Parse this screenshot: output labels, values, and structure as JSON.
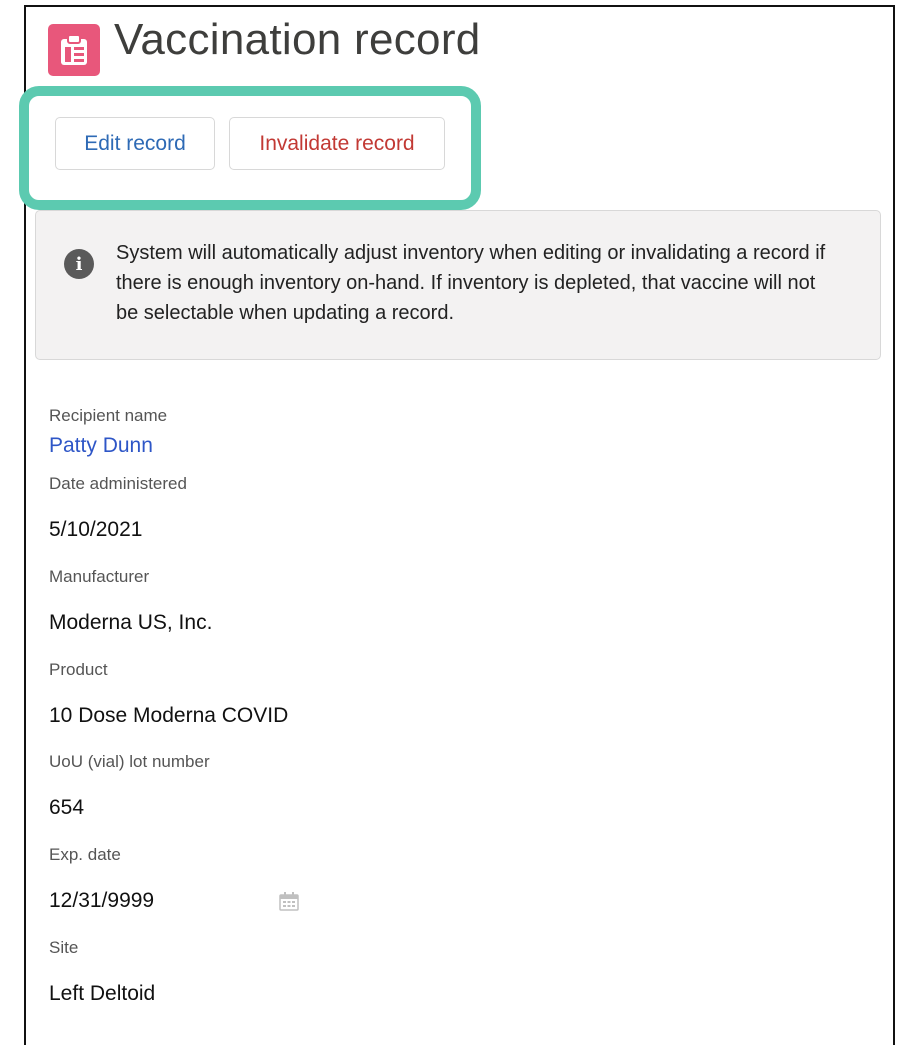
{
  "header": {
    "title": "Vaccination record",
    "icon": "clipboard-icon",
    "icon_color": "#e8577b"
  },
  "actions": {
    "edit_label": "Edit record",
    "invalidate_label": "Invalidate record",
    "highlight_color": "#5ccab0"
  },
  "info": {
    "icon": "info-icon",
    "message": "System will automatically adjust inventory when editing or invalidating a record if there is enough inventory on-hand. If inventory is depleted, that vaccine will not be selectable when updating a record."
  },
  "fields": {
    "recipient": {
      "label": "Recipient name",
      "value": "Patty Dunn"
    },
    "date_administered": {
      "label": "Date administered",
      "value": "5/10/2021"
    },
    "manufacturer": {
      "label": "Manufacturer",
      "value": "Moderna US, Inc."
    },
    "product": {
      "label": "Product",
      "value": "10 Dose Moderna COVID"
    },
    "lot_number": {
      "label": "UoU (vial) lot number",
      "value": "654"
    },
    "exp_date": {
      "label": "Exp. date",
      "value": "12/31/9999",
      "icon": "calendar-icon"
    },
    "site": {
      "label": "Site",
      "value": "Left Deltoid"
    }
  }
}
